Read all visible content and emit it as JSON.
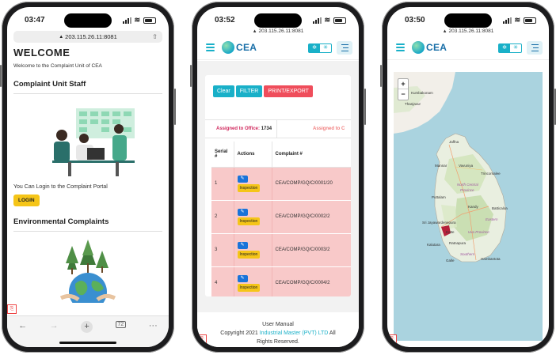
{
  "phone1": {
    "time": "03:47",
    "url": "203.115.26.11:8081",
    "title": "WELCOME",
    "subtitle": "Welcome to the Complaint Unit of CEA",
    "section1": "Complaint Unit Staff",
    "login_prompt": "You Can Login to the Complaint Portal",
    "login_button": "LOGIN",
    "section2": "Environmental Complaints",
    "tab_count": "72"
  },
  "phone2": {
    "time": "03:52",
    "url": "203.115.26.11:8081",
    "logo": "CEA",
    "buttons": {
      "clear": "Clear",
      "filter": "FILTER",
      "print": "PRINT/EXPORT"
    },
    "assigned_office_label": "Assigned to Office:",
    "assigned_office_count": "1734",
    "assigned_other_label": "Assigned to C",
    "columns": [
      "Serial #",
      "Actions",
      "Complaint #"
    ],
    "inspection_label": "Inspection",
    "rows": [
      {
        "serial": "1",
        "complaint": "CEA/COMP/GQ/C/0001/20"
      },
      {
        "serial": "2",
        "complaint": "CEA/COMP/GQ/C/0002/2"
      },
      {
        "serial": "3",
        "complaint": "CEA/COMP/GQ/C/0003/2"
      },
      {
        "serial": "4",
        "complaint": "CEA/COMP/GQ/C/0004/2"
      }
    ],
    "footer": {
      "manual": "User Manual",
      "copyright_prefix": "Copyright 2021",
      "company": "Industrial Master (PVT) LTD",
      "suffix": "All",
      "rights": "Rights Reserved."
    }
  },
  "phone3": {
    "time": "03:50",
    "url": "203.115.26.11:8081",
    "logo": "CEA",
    "zoom_in": "+",
    "zoom_out": "−",
    "labels": {
      "kumbakonam": "Kumbakonam",
      "thanjavur": "Thanjavur",
      "jaffna": "Jaffna",
      "mannar": "Mannar",
      "vavuniya": "Vavuniya",
      "trincomalee": "Trincomalee",
      "north_central": "North Central",
      "province": "Province",
      "puttalam": "Puttalam",
      "batticaloa": "Batticaloa",
      "kandy": "Kandy",
      "eastern": "Eastern",
      "sri_jaya": "Sri Jayawardenepura",
      "kotte": "Kotte",
      "kalutara": "Kalutara",
      "ratnapura": "Ratnapura",
      "southern": "Southern",
      "galle": "Galle",
      "hambantota": "Hambantota",
      "uva": "Uva Province",
      "sabaragamuwa": "Sabaragamuwa"
    }
  },
  "colors": {
    "teal": "#19b0c8",
    "red": "#ef4d5b",
    "yellow": "#f5c518",
    "row_pink": "#f8c9c9",
    "sea": "#aad3df",
    "land": "#f2efe9"
  }
}
